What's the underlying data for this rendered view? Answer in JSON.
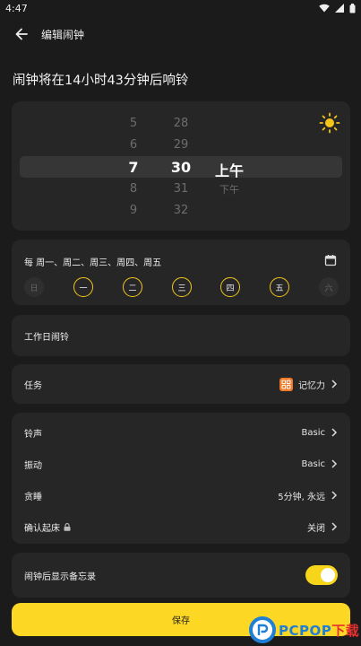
{
  "status_bar": {
    "time": "4:47"
  },
  "app_bar": {
    "title": "编辑闹钟"
  },
  "headline": "闹钟将在14小时43分钟后响铃",
  "time_picker": {
    "hours": [
      "5",
      "6",
      "7",
      "8",
      "9"
    ],
    "minutes": [
      "28",
      "29",
      "30",
      "31",
      "32"
    ],
    "periods": [
      "上午",
      "下午"
    ],
    "selected_hour": "7",
    "selected_minute": "30",
    "selected_period": "上午"
  },
  "repeat": {
    "label": "每 周一、周二、周三、周四、周五",
    "days": [
      {
        "label": "日",
        "active": false
      },
      {
        "label": "一",
        "active": true
      },
      {
        "label": "二",
        "active": true
      },
      {
        "label": "三",
        "active": true
      },
      {
        "label": "四",
        "active": true
      },
      {
        "label": "五",
        "active": true
      },
      {
        "label": "六",
        "active": false
      }
    ]
  },
  "workday": {
    "label": "工作日闹铃"
  },
  "task": {
    "label": "任务",
    "value": "记忆力"
  },
  "settings": {
    "ringtone": {
      "label": "铃声",
      "value": "Basic"
    },
    "vibration": {
      "label": "振动",
      "value": "Basic"
    },
    "snooze": {
      "label": "贪睡",
      "value": "5分钟, 永远"
    },
    "confirm_wake": {
      "label": "确认起床",
      "value": "关闭"
    }
  },
  "memo": {
    "label": "闹钟后显示备忘录",
    "enabled": true
  },
  "save_label": "保存",
  "watermark": {
    "latin": "PCPOP",
    "cn": "下载"
  },
  "colors": {
    "accent": "#fcd723",
    "task_badge": "#f07c2b",
    "background": "#1b1b1b",
    "card": "#262626"
  }
}
